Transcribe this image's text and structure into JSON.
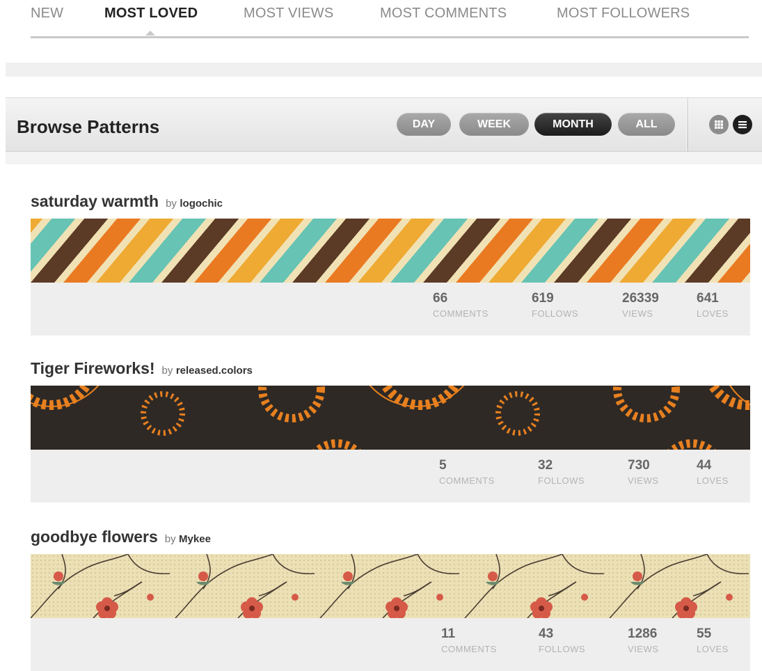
{
  "sort_tabs": [
    {
      "label": "NEW"
    },
    {
      "label": "MOST LOVED",
      "active": true
    },
    {
      "label": "MOST VIEWS"
    },
    {
      "label": "MOST COMMENTS"
    },
    {
      "label": "MOST FOLLOWERS"
    }
  ],
  "browse": {
    "title": "Browse Patterns",
    "periods": [
      {
        "label": "DAY"
      },
      {
        "label": "WEEK"
      },
      {
        "label": "MONTH",
        "active": true
      },
      {
        "label": "ALL"
      }
    ],
    "view_icons": [
      "grid-view-icon",
      "list-view-icon"
    ]
  },
  "stat_labels": {
    "comments": "COMMENTS",
    "follows": "FOLLOWS",
    "views": "VIEWS",
    "loves": "LOVES"
  },
  "patterns": [
    {
      "title": "saturday warmth",
      "by": "by",
      "author": "logochic",
      "comments": "66",
      "follows": "619",
      "views": "26339",
      "loves": "641",
      "colors": [
        "#f1e2b6",
        "#ea7a22",
        "#5b3a26",
        "#67c3b4",
        "#efaa33"
      ]
    },
    {
      "title": "Tiger Fireworks!",
      "by": "by",
      "author": "released.colors",
      "comments": "5",
      "follows": "32",
      "views": "730",
      "loves": "44",
      "colors": [
        "#2e2925",
        "#e8801f"
      ]
    },
    {
      "title": "goodbye flowers",
      "by": "by",
      "author": "Mykee",
      "comments": "11",
      "follows": "43",
      "views": "1286",
      "loves": "55",
      "colors": [
        "#ece0b6",
        "#d65a48",
        "#6a8a6e",
        "#4a3f33"
      ]
    }
  ]
}
